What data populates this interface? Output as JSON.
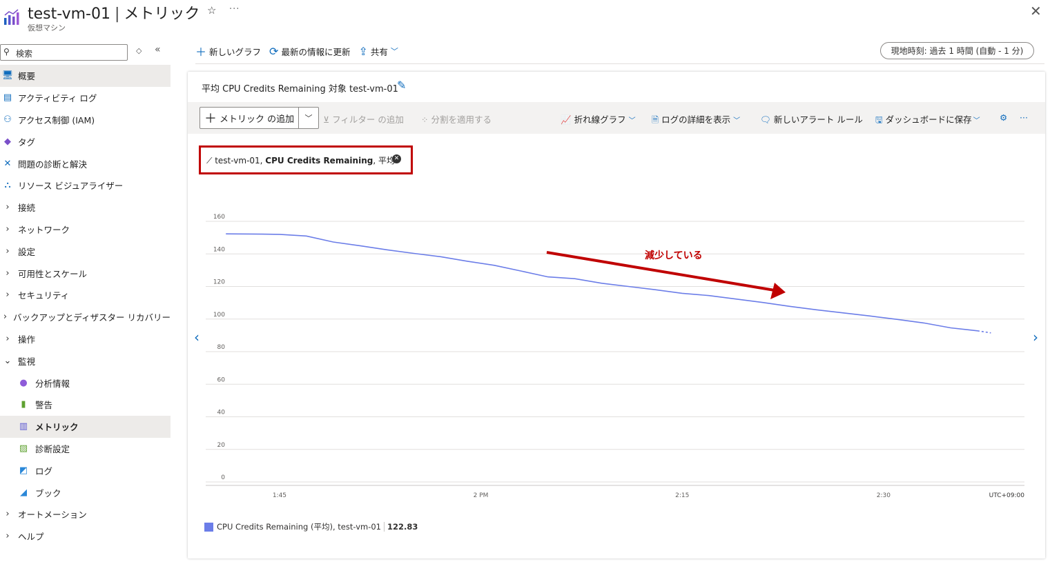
{
  "header": {
    "title": "test-vm-01",
    "separator": "|",
    "page": "メトリック",
    "subtitle": "仮想マシン"
  },
  "sidebar": {
    "search_placeholder": "検索",
    "items": [
      {
        "label": "概要",
        "icon": "monitor-icon",
        "selected": true
      },
      {
        "label": "アクティビティ ログ",
        "icon": "log-icon"
      },
      {
        "label": "アクセス制御 (IAM)",
        "icon": "people-icon"
      },
      {
        "label": "タグ",
        "icon": "tag-icon"
      },
      {
        "label": "問題の診断と解決",
        "icon": "wrench-icon"
      },
      {
        "label": "リソース ビジュアライザー",
        "icon": "hierarchy-icon"
      },
      {
        "label": "接続",
        "chevron": "right"
      },
      {
        "label": "ネットワーク",
        "chevron": "right"
      },
      {
        "label": "設定",
        "chevron": "right"
      },
      {
        "label": "可用性とスケール",
        "chevron": "right"
      },
      {
        "label": "セキュリティ",
        "chevron": "right"
      },
      {
        "label": "バックアップとディザスター リカバリー",
        "chevron": "right"
      },
      {
        "label": "操作",
        "chevron": "right"
      },
      {
        "label": "監視",
        "chevron": "down"
      },
      {
        "label": "分析情報",
        "icon": "bulb-icon",
        "child": true
      },
      {
        "label": "警告",
        "icon": "alert-icon",
        "child": true
      },
      {
        "label": "メトリック",
        "icon": "metrics-icon",
        "child": true,
        "selected": true
      },
      {
        "label": "診断設定",
        "icon": "diagnostics-icon",
        "child": true
      },
      {
        "label": "ログ",
        "icon": "logs-icon",
        "child": true
      },
      {
        "label": "ブック",
        "icon": "workbook-icon",
        "child": true
      },
      {
        "label": "オートメーション",
        "chevron": "right"
      },
      {
        "label": "ヘルプ",
        "chevron": "right"
      }
    ]
  },
  "toolbar": {
    "new_chart": "新しいグラフ",
    "refresh": "最新の情報に更新",
    "share": "共有",
    "time_range": "現地時刻: 過去 1 時間 (自動 - 1 分)"
  },
  "card": {
    "title": "平均 CPU Credits Remaining 対象 test-vm-01",
    "add_metric": "メトリック の追加",
    "add_filter": "フィルター の追加",
    "apply_split": "分割を適用する",
    "chart_type": "折れ線グラフ",
    "view_logs": "ログの詳細を表示",
    "new_alert": "新しいアラート ルール",
    "save_dashboard": "ダッシュボードに保存",
    "pill_prefix": "test-vm-01, ",
    "pill_metric": "CPU Credits Remaining",
    "pill_suffix": ", 平均",
    "annotation": "減少している",
    "legend_label": "CPU Credits Remaining (平均), test-vm-01",
    "legend_value": "122.83",
    "colors": {
      "series": "#6b7de8",
      "annotation": "#c00000",
      "accent": "#0f6cbd"
    }
  },
  "chart_data": {
    "type": "line",
    "ylim": [
      0,
      160
    ],
    "yticks": [
      "0",
      "20",
      "40",
      "60",
      "80",
      "100",
      "120",
      "140",
      "160"
    ],
    "xtick_labels": [
      "1:45",
      "2 PM",
      "2:15",
      "2:30"
    ],
    "xtick_minutes": [
      45,
      60,
      75,
      90
    ],
    "xlim_minutes": [
      39.5,
      100.5
    ],
    "timezone_label": "UTC+09:00",
    "grid": true,
    "series": [
      {
        "name": "CPU Credits Remaining (平均), test-vm-01",
        "x_minutes": [
          41,
          43,
          45,
          47,
          49,
          51,
          53,
          55,
          57,
          59,
          61,
          63,
          65,
          67,
          69,
          71,
          73,
          75,
          77,
          79,
          81,
          83,
          85,
          87,
          89,
          91,
          93,
          95,
          97,
          98
        ],
        "values": [
          152.3,
          152.2,
          152.0,
          151.0,
          147.3,
          145.0,
          142.5,
          140.3,
          138.3,
          135.5,
          133.0,
          129.5,
          125.9,
          124.8,
          122.0,
          120.0,
          118.0,
          115.8,
          114.4,
          112.3,
          110.2,
          107.8,
          105.7,
          103.8,
          101.9,
          99.8,
          97.6,
          94.6,
          92.8,
          91.5
        ]
      }
    ]
  }
}
